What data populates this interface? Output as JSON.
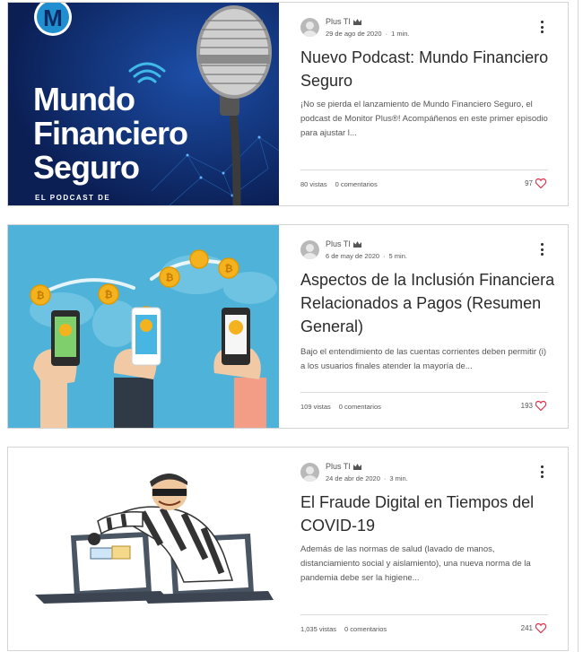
{
  "posts": [
    {
      "author": "Plus TI",
      "date": "29 de ago de 2020",
      "read_time": "1 min.",
      "title": "Nuevo Podcast: Mundo Financiero Seguro",
      "excerpt": "¡No se pierda el lanzamiento de Mundo Financiero Seguro, el podcast de Monitor Plus®! Acompáñenos en este primer episodio para ajustar l...",
      "views": "80 vistas",
      "comments": "0 comentarios",
      "likes": "97",
      "image": {
        "brand_letter": "M",
        "headline_lines": [
          "Mundo",
          "Financiero",
          "Seguro"
        ],
        "tagline": "EL PODCAST DE"
      }
    },
    {
      "author": "Plus TI",
      "date": "6 de may de 2020",
      "read_time": "5 min.",
      "title": "Aspectos de la Inclusión Financiera Relacionados a Pagos (Resumen General)",
      "excerpt": "Bajo el entendimiento de las cuentas corrientes deben permitir (i) a los usuarios finales atender la mayoría de...",
      "views": "109 vistas",
      "comments": "0 comentarios",
      "likes": "193",
      "image": {
        "coin_symbol": "₿"
      }
    },
    {
      "author": "Plus TI",
      "date": "24 de abr de 2020",
      "read_time": "3 min.",
      "title": "El Fraude Digital en Tiempos del COVID-19",
      "excerpt": "Además de las normas de salud (lavado de manos, distanciamiento social y aislamiento), una nueva norma de la pandemia debe ser la higiene...",
      "views": "1,035 vistas",
      "comments": "0 comentarios",
      "likes": "241",
      "image": {}
    }
  ],
  "colors": {
    "like_heart": "#e3324a",
    "podcast_bg": "#0d2a66",
    "podcast_accent": "#3fb9e8",
    "fintech_bg": "#4fb3d9",
    "coin": "#f4b21e"
  }
}
